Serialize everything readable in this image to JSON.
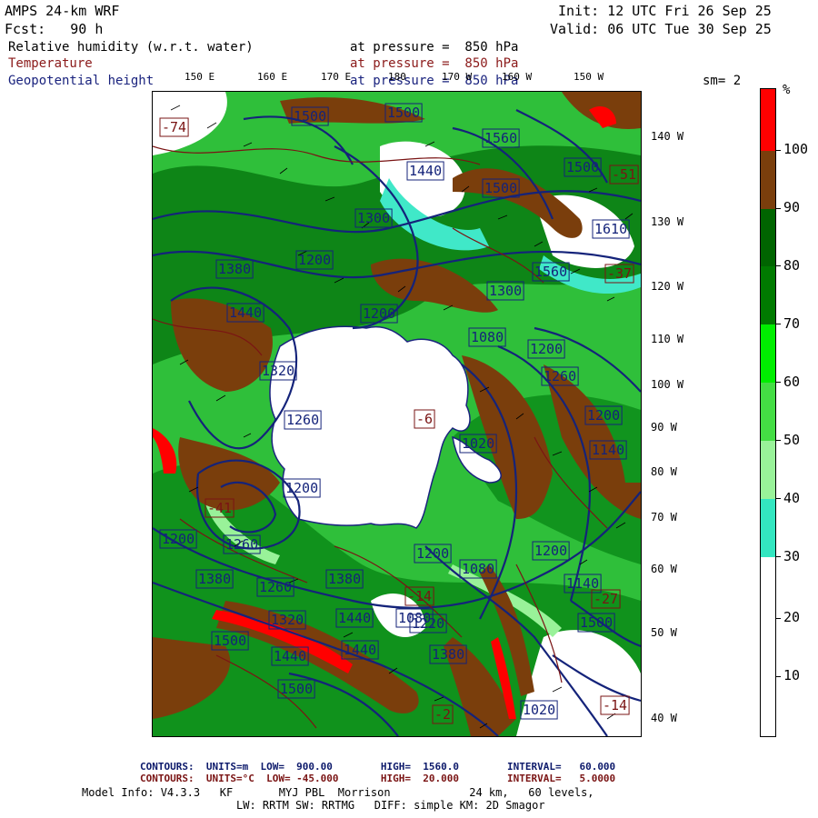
{
  "header": {
    "model": "AMPS 24-km WRF",
    "forecast": "Fcst:   90 h",
    "init": "Init: 12 UTC Fri 26 Sep 25",
    "valid": "Valid: 06 UTC Tue 30 Sep 25",
    "fields": [
      {
        "name": "Relative humidity (w.r.t. water)",
        "level": "at pressure =  850 hPa",
        "color": "#000000"
      },
      {
        "name": "Temperature",
        "level": "at pressure =  850 hPa",
        "color": "#8b1a1a"
      },
      {
        "name": "Geopotential height",
        "level": "at pressure =  850 hPa",
        "color": "#1a237e"
      }
    ],
    "smoothing": "sm= 2"
  },
  "longitude_labels": [
    "150 E",
    "160 E",
    "170 E",
    "180",
    "170 W",
    "160 W",
    "150 W"
  ],
  "latitude_labels": [
    "140 W",
    "130 W",
    "120 W",
    "110 W",
    "100 W",
    "90 W",
    "80 W",
    "70 W",
    "60 W",
    "50 W",
    "40 W"
  ],
  "legend": {
    "unit": "%",
    "values": [
      "100",
      "90",
      "80",
      "70",
      "60",
      "50",
      "40",
      "30",
      "20",
      "10"
    ],
    "bands": [
      {
        "from": 0,
        "to": 10,
        "color": "#ffffff"
      },
      {
        "from": 10,
        "to": 20,
        "color": "#ffffff"
      },
      {
        "from": 20,
        "to": 30,
        "color": "#ffffff"
      },
      {
        "from": 30,
        "to": 40,
        "color": "#33e6c0"
      },
      {
        "from": 40,
        "to": 50,
        "color": "#99f299"
      },
      {
        "from": 50,
        "to": 60,
        "color": "#44dd44"
      },
      {
        "from": 60,
        "to": 70,
        "color": "#00ee00"
      },
      {
        "from": 70,
        "to": 80,
        "color": "#007a00"
      },
      {
        "from": 80,
        "to": 90,
        "color": "#006400"
      },
      {
        "from": 90,
        "to": 100,
        "color": "#7a3e0c"
      },
      {
        "from": 100,
        "to": 110,
        "color": "#ff0000"
      }
    ]
  },
  "map_labels": {
    "height_contours": [
      "1500",
      "1500",
      "1440",
      "1500",
      "1560",
      "1500",
      "1610",
      "1380",
      "1300",
      "1560",
      "1440",
      "1300",
      "1200",
      "1200",
      "1320",
      "1260",
      "1080",
      "1200",
      "1260",
      "1020",
      "1200",
      "1140",
      "1200",
      "1200",
      "1260",
      "1200",
      "1080",
      "1200",
      "1140",
      "1380",
      "1380",
      "1260",
      "1080",
      "1440",
      "1500",
      "1440",
      "1320",
      "1440",
      "1220",
      "1380",
      "1500",
      "1020",
      "1500"
    ],
    "temperature_contours": [
      "-74",
      "-51",
      "-37",
      "-41",
      "-14",
      "-27",
      "-14",
      "-6",
      "-2"
    ]
  },
  "footer": {
    "line1": "CONTOURS:  UNITS=m  LOW=  900.00        HIGH=  1560.0        INTERVAL=   60.000",
    "line2": "CONTOURS:  UNITS=°C  LOW= -45.000       HIGH=  20.000        INTERVAL=   5.0000",
    "line3": "Model Info: V4.3.3   KF       MYJ PBL  Morrison            24 km,   60 levels,",
    "line4": "LW: RRTM SW: RRTMG   DIFF: simple KM: 2D Smagor"
  }
}
